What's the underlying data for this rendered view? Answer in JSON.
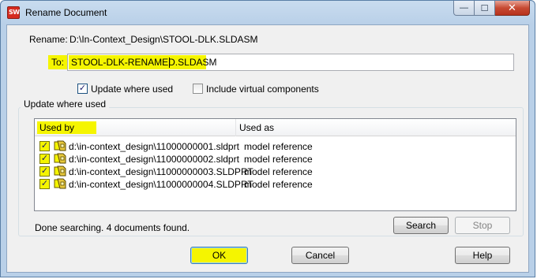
{
  "window": {
    "title": "Rename Document",
    "app_icon_text": "SW",
    "controls": {
      "minimize": "—",
      "maximize": "☐",
      "close": "✕"
    }
  },
  "form": {
    "rename_label": "Rename:",
    "rename_value": "D:\\In-Context_Design\\STOOL-DLK.SLDASM",
    "to_label": "To:",
    "to_value": "STOOL-DLK-RENAMED.SLDASM",
    "update_where_used": {
      "label": "Update where used",
      "checked": true
    },
    "include_virtual": {
      "label": "Include virtual components",
      "checked": false
    }
  },
  "group": {
    "title": "Update where used",
    "columns": [
      "Used by",
      "Used as"
    ],
    "rows": [
      {
        "checked": true,
        "file": "d:\\in-context_design\\11000000001.sldprt",
        "used_as": "model reference"
      },
      {
        "checked": true,
        "file": "d:\\in-context_design\\11000000002.sldprt",
        "used_as": "model reference"
      },
      {
        "checked": true,
        "file": "d:\\in-context_design\\11000000003.SLDPRT",
        "used_as": "model reference"
      },
      {
        "checked": true,
        "file": "d:\\in-context_design\\11000000004.SLDPRT",
        "used_as": "model reference"
      }
    ],
    "status": "Done searching.  4 documents found.",
    "search_button": "Search",
    "stop_button": "Stop"
  },
  "buttons": {
    "ok": "OK",
    "cancel": "Cancel",
    "help": "Help"
  },
  "colors": {
    "highlight": "#f5f500",
    "titlebar": "#b9d0e8"
  }
}
